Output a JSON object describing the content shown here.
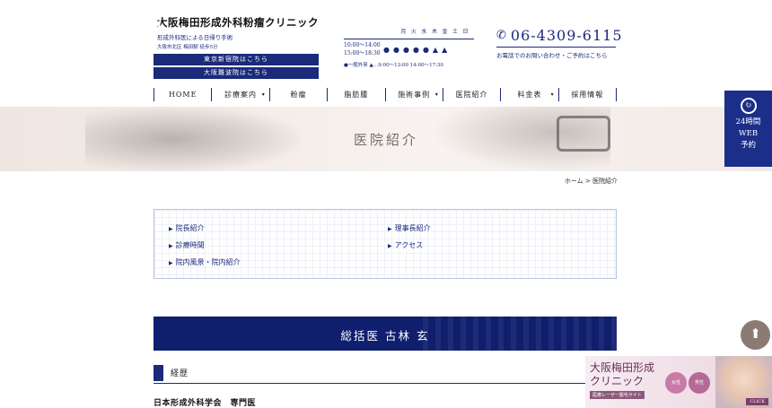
{
  "header": {
    "clinic_name": "大阪梅田形成外科粉瘤クリニック",
    "tagline": "形成外科医による日帰り手術",
    "address": "大阪市北区 梅田駅 徒歩5分",
    "branch_buttons": [
      "東京新宿院はこちら",
      "大阪難波院はこちら"
    ]
  },
  "hours": {
    "days": [
      "月",
      "火",
      "水",
      "木",
      "金",
      "土",
      "日"
    ],
    "time_am": "10:00〜14:00",
    "time_pm": "15:00〜18:30",
    "marks": [
      "●",
      "●",
      "●",
      "●",
      "●",
      "▲",
      "▲"
    ],
    "note": "●一般外来  ▲…9:00〜13:00 14:00〜17:30"
  },
  "contact": {
    "phone": "06-4309-6115",
    "note": "お電話でのお問い合わせ・ご予約はこちら"
  },
  "nav": {
    "items": [
      "HOME",
      "診療案内",
      "粉瘤",
      "脂肪腫",
      "施術事例",
      "医院紹介",
      "料金表",
      "採用情報"
    ]
  },
  "hero": {
    "title": "医院紹介"
  },
  "breadcrumb": "ホーム > 医院紹介",
  "toc": {
    "items": [
      "院長紹介",
      "理事長紹介",
      "診療時間",
      "アクセス",
      "院内風景・院内紹介"
    ]
  },
  "director": {
    "title": "総括医 古林 玄"
  },
  "career": {
    "title": "経歴"
  },
  "certification": "日本形成外科学会　専門医",
  "side": {
    "web_reserve": [
      "24時間",
      "WEB",
      "予約"
    ]
  },
  "ad": {
    "title_line1": "大阪梅田形成",
    "title_line2": "クリニック",
    "sub": "医療レーザー脱毛サイト",
    "badge1": "女性",
    "badge2": "男性",
    "click": "CLICK"
  },
  "colors": {
    "brand": "#1b2a7a",
    "banner": "#101e6e",
    "side": "#1b2f8a"
  }
}
